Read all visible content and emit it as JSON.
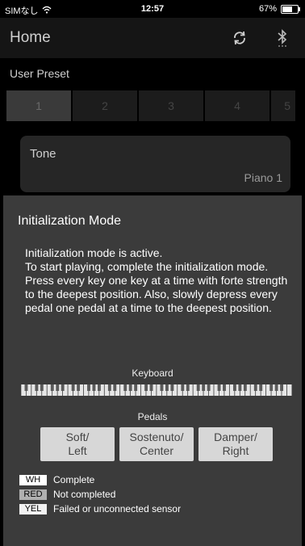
{
  "status": {
    "carrier": "SIMなし",
    "time": "12:57",
    "battery": "67%",
    "battery_level": 0.67
  },
  "nav": {
    "title": "Home"
  },
  "preset": {
    "label": "User Preset",
    "tabs": [
      "1",
      "2",
      "3",
      "4",
      "5"
    ]
  },
  "tone": {
    "label": "Tone",
    "value": "Piano 1"
  },
  "modal": {
    "title": "Initialization Mode",
    "description": "Initialization mode is active.\nTo start playing, complete the initialization mode. Press every key one key at a time with forte strength to the deepest position. Also, slowly depress every pedal one pedal at a time to the deepest position.",
    "keyboard_label": "Keyboard",
    "pedals_label": "Pedals",
    "pedals": [
      "Soft/\nLeft",
      "Sostenuto/\nCenter",
      "Damper/\nRight"
    ],
    "legend": [
      {
        "badge": "WH",
        "text": "Complete"
      },
      {
        "badge": "RED",
        "text": "Not completed"
      },
      {
        "badge": "YEL",
        "text": "Failed or unconnected sensor"
      }
    ]
  }
}
